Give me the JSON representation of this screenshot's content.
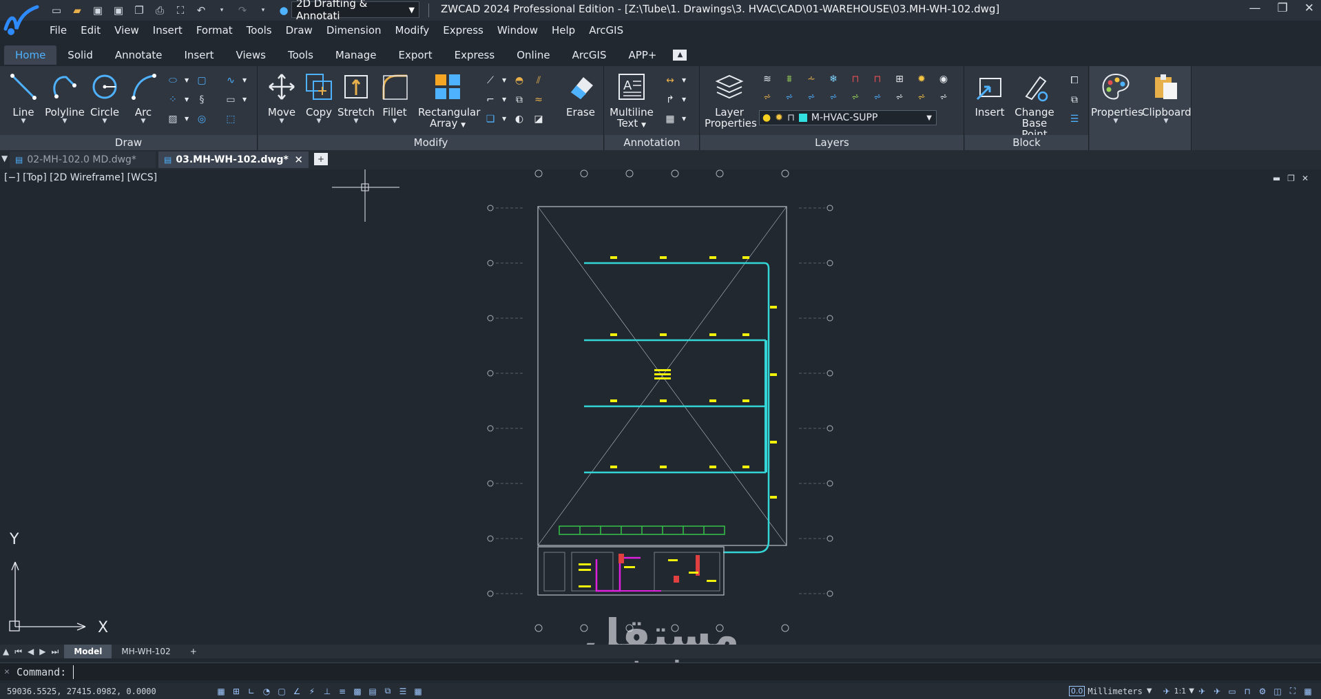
{
  "titlebar": {
    "workspace": "2D Drafting & Annotati",
    "title": "ZWCAD 2024 Professional Edition - [Z:\\Tube\\1. Drawings\\3. HVAC\\CAD\\01-WAREHOUSE\\03.MH-WH-102.dwg]"
  },
  "menu": [
    "File",
    "Edit",
    "View",
    "Insert",
    "Format",
    "Tools",
    "Draw",
    "Dimension",
    "Modify",
    "Express",
    "Window",
    "Help",
    "ArcGIS"
  ],
  "ribbon_tabs": [
    "Home",
    "Solid",
    "Annotate",
    "Insert",
    "Views",
    "Tools",
    "Manage",
    "Export",
    "Express",
    "Online",
    "ArcGIS",
    "APP+"
  ],
  "panels": {
    "draw": {
      "title": "Draw",
      "tools": [
        "Line",
        "Polyline",
        "Circle",
        "Arc"
      ]
    },
    "modify": {
      "title": "Modify",
      "tools": [
        "Move",
        "Copy",
        "Stretch",
        "Fillet"
      ],
      "array_l1": "Rectangular",
      "array_l2": "Array",
      "erase": "Erase"
    },
    "annotation": {
      "title": "Annotation",
      "mtext_l1": "Multiline",
      "mtext_l2": "Text"
    },
    "layers": {
      "title": "Layers",
      "props_l1": "Layer",
      "props_l2": "Properties",
      "current_layer": "M-HVAC-SUPP"
    },
    "block": {
      "title": "Block",
      "insert": "Insert",
      "cbp_l1": "Change",
      "cbp_l2": "Base Point"
    },
    "properties": {
      "label": "Properties"
    },
    "clipboard": {
      "label": "Clipboard"
    }
  },
  "doc_tabs": {
    "inactive": "02-MH-102.0 MD.dwg*",
    "active": "03.MH-WH-102.dwg*"
  },
  "viewport": {
    "label": "[−] [Top] [2D Wireframe] [WCS]"
  },
  "ucs": {
    "y": "Y",
    "x": "X"
  },
  "layout_tabs": [
    "Model",
    "MH-WH-102",
    "+"
  ],
  "command": {
    "prompt": "Command:"
  },
  "status": {
    "coords": "59036.5525, 27415.0982, 0.0000",
    "precision": "0.0",
    "units": "Millimeters",
    "scale": "1:1"
  },
  "watermark": {
    "arabic": "مستقل",
    "latin": "mostaql.com"
  },
  "colors": {
    "accent": "#4fb2ff",
    "duct": "#33d6d6",
    "label": "#f2f20a",
    "pipe": "#e020e0"
  }
}
